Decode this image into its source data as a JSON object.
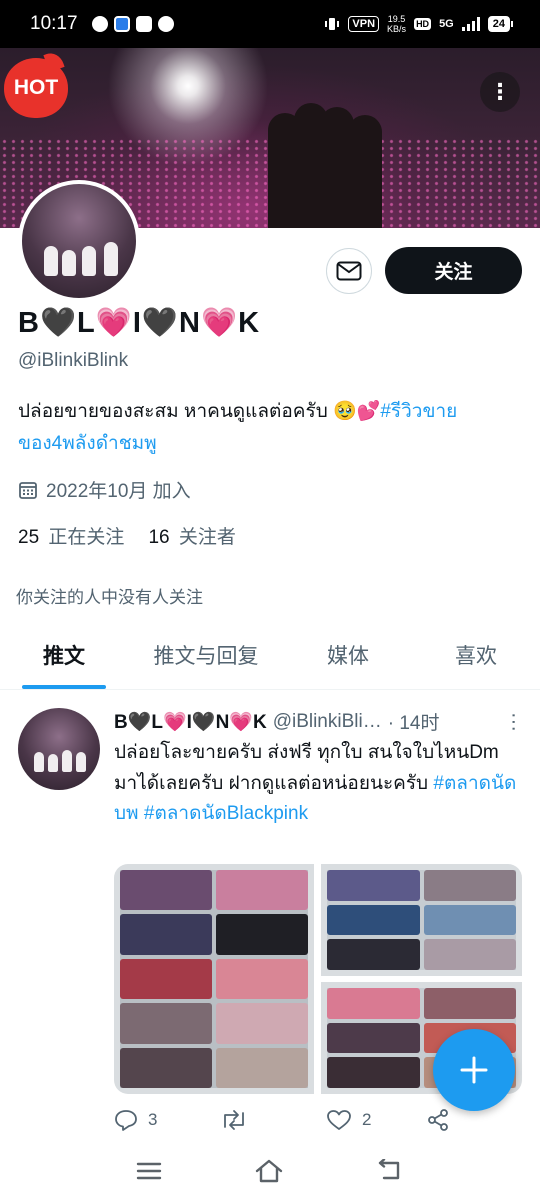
{
  "status_bar": {
    "time": "10:17",
    "vpn": "VPN",
    "speed_value": "19.5",
    "speed_unit": "KB/s",
    "hd": "HD",
    "network": "5G",
    "battery": "24"
  },
  "banner": {
    "hot_label": "HOT",
    "more_label": "⋮"
  },
  "profile": {
    "follow_label": "关注",
    "display_name": "B🖤L💗I🖤N💗K",
    "handle": "@iBlinkiBlink",
    "bio_text": "ปล่อยขายของสะสม  หาคนดูแลต่อครับ 🥹💕",
    "bio_link": "#รีวิวขายของ4พลังดำชมพู",
    "joined": "2022年10月 加入",
    "following_count": "25",
    "following_label": "正在关注",
    "followers_count": "16",
    "followers_label": "关注者",
    "followers_note": "你关注的人中没有人关注"
  },
  "tabs": [
    {
      "label": "推文"
    },
    {
      "label": "推文与回复"
    },
    {
      "label": "媒体"
    },
    {
      "label": "喜欢"
    }
  ],
  "tweet": {
    "name": "B🖤L💗I🖤N💗K",
    "handle": "@iBlinkiBli…",
    "time": "· 14时",
    "text": "ปล่อยโละขายครับ ส่งฟรี ทุกใบ สนใจใบไหนDm มาได้เลยครับ ฝากดูแลต่อหน่อยนะครับ ",
    "tag1": "#ตลาดนัดบพ",
    "tag2": "#ตลาดนัดBlackpink",
    "replies": "3",
    "likes": "2"
  },
  "colors": {
    "accent": "#1d9bf0",
    "text": "#0f1419",
    "muted": "#536471"
  }
}
